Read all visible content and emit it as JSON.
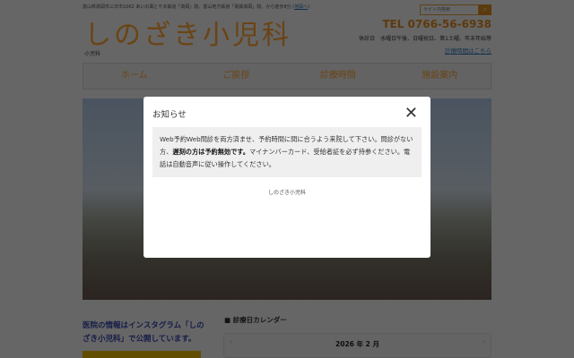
{
  "header": {
    "address": "富山県高岡市三日市1062 あいの風とやま鉄道「高岡」駅、富山地方鉄道「電鉄高岡」駅、から徒歩8分",
    "map_link": "地図へ",
    "search_placeholder": "サイト内検索",
    "search_icon": "search-icon",
    "logo": "しのざき小児科",
    "subtitle": "小児科",
    "tel": "TEL 0766-56-6938",
    "holidays": "休診日　水曜日午後、日曜祝日、第1土曜、年末年始等",
    "hours_link": "診療時間はこちら"
  },
  "nav": [
    "ホーム",
    "ご挨拶",
    "診療時間",
    "施設案内"
  ],
  "sidebar": {
    "instagram_text": "医院の情報はインスタグラム「しのざき小児科」で公開しています。"
  },
  "calendar": {
    "heading": "■ 診療日カレンダー",
    "month": "2026 年 2 月",
    "prev": "‹",
    "next": "›"
  },
  "modal": {
    "title": "お知らせ",
    "close": "✕",
    "body_1": "Web予約Web問診を両方済ませ、予約時間に間に合うよう来院して下さい。問診がない方、",
    "body_bold": "遅刻の方は予約無効です。",
    "body_2": "マイナンバーカード、受給者証を必ず持参ください。電話は自動音声に従い操作してください。",
    "footer": "しのざき小児科"
  },
  "colors": {
    "accent": "#e8912c",
    "link": "#2a6fb8"
  }
}
